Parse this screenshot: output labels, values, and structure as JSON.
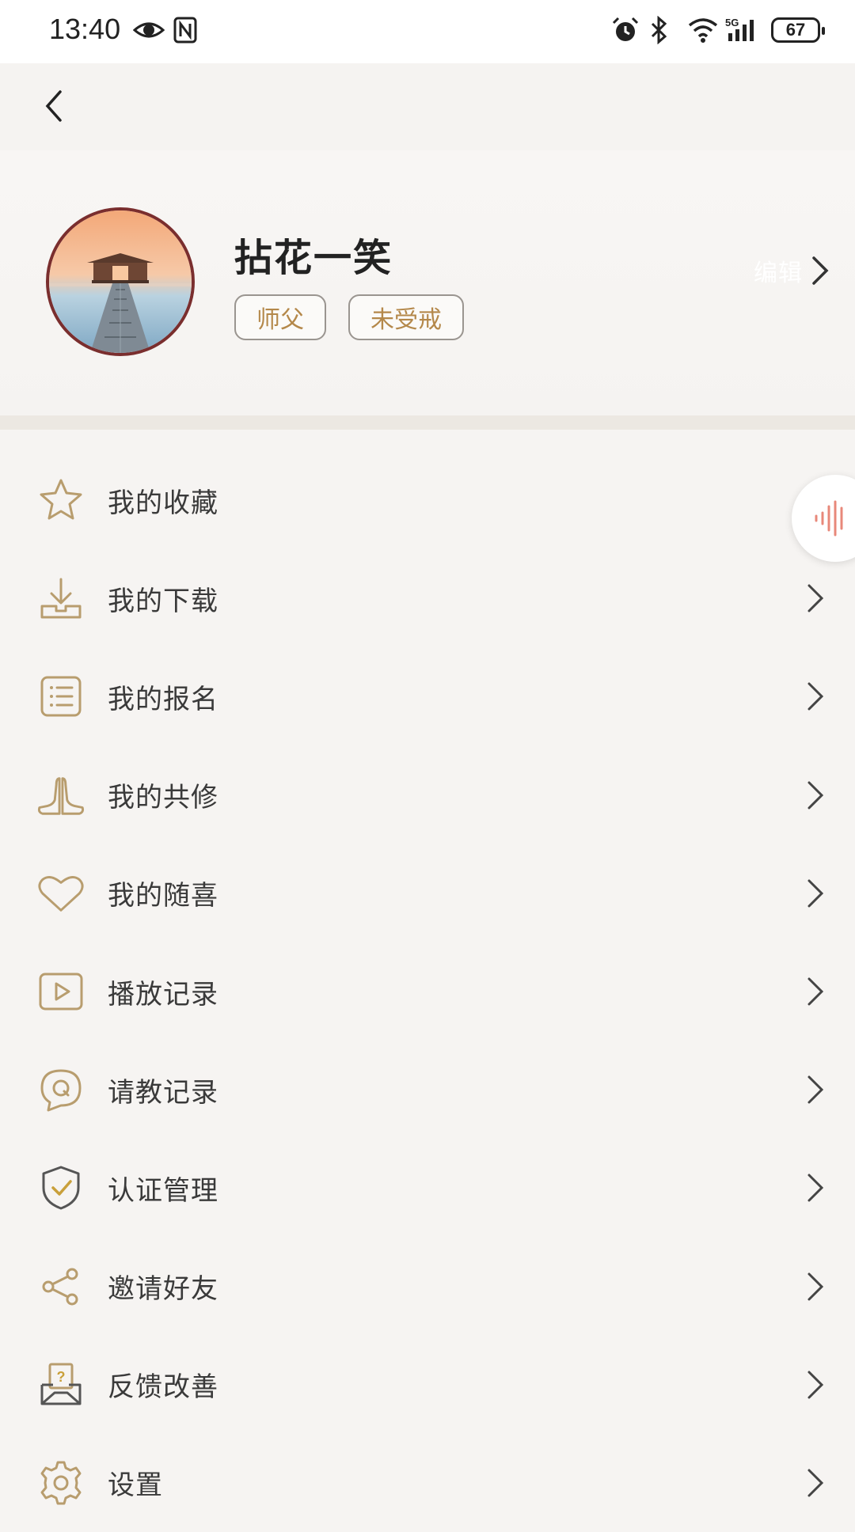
{
  "status_bar": {
    "time": "13:40",
    "left_icons": [
      "eye-icon",
      "nfc-icon"
    ],
    "right_icons": [
      "alarm-icon",
      "bluetooth-icon",
      "wifi-icon",
      "signal-5g-icon"
    ],
    "network": "5G",
    "battery": "67"
  },
  "nav": {
    "back_icon": "chevron-left-icon"
  },
  "profile": {
    "username": "拈花一笑",
    "tags": [
      "师父",
      "未受戒"
    ],
    "edit_label": "编辑",
    "avatar_image": "pier-sunset-photo"
  },
  "menu": {
    "items": [
      {
        "label": "我的收藏",
        "icon": "star-icon"
      },
      {
        "label": "我的下载",
        "icon": "download-icon"
      },
      {
        "label": "我的报名",
        "icon": "list-icon"
      },
      {
        "label": "我的共修",
        "icon": "praying-hands-icon"
      },
      {
        "label": "我的随喜",
        "icon": "heart-icon"
      },
      {
        "label": "播放记录",
        "icon": "play-icon"
      },
      {
        "label": "请教记录",
        "icon": "question-bubble-icon"
      },
      {
        "label": "认证管理",
        "icon": "shield-check-icon"
      },
      {
        "label": "邀请好友",
        "icon": "share-icon"
      },
      {
        "label": "反馈改善",
        "icon": "feedback-icon"
      },
      {
        "label": "设置",
        "icon": "gear-icon"
      }
    ]
  },
  "colors": {
    "accent_gold": "#b89d6e",
    "tag_text": "#b4884a",
    "background": "#f6f4f2",
    "voice_accent": "#e8887a"
  }
}
